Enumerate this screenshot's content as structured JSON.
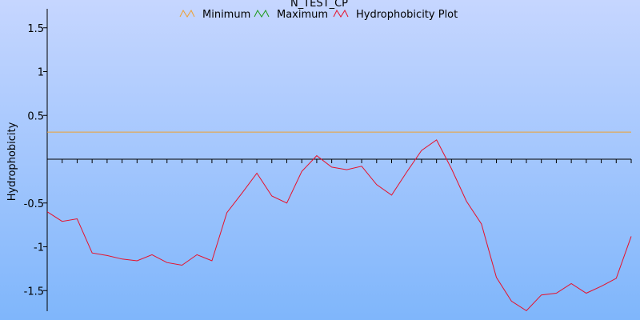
{
  "chart_data": {
    "type": "line",
    "title": "N_TEST_CP",
    "ylabel": "Hydrophobicity",
    "xlabel": "",
    "ylim": [
      -1.73,
      1.72
    ],
    "y_ticks": [
      1.5,
      1,
      0.5,
      -0.5,
      -1,
      -1.5
    ],
    "y_tick_labels": [
      "1.5",
      "1",
      "0.5",
      "-0.5",
      "-1",
      "-1.5"
    ],
    "x_range": [
      0,
      39
    ],
    "x_tick_count": 39,
    "legend_position": "top",
    "grid": false,
    "series": [
      {
        "name": "Minimum",
        "color": "#f0a030",
        "x": [
          0,
          39
        ],
        "values": [
          0.31,
          0.31
        ]
      },
      {
        "name": "Maximum",
        "color": "#1a9a1a",
        "x": [],
        "values": []
      },
      {
        "name": "Hydrophobicity Plot",
        "color": "#e8102a",
        "x": [
          0,
          1,
          2,
          3,
          4,
          5,
          6,
          7,
          8,
          9,
          10,
          11,
          12,
          13,
          14,
          15,
          16,
          17,
          18,
          19,
          20,
          21,
          22,
          23,
          24,
          25,
          26,
          27,
          28,
          29,
          30,
          31,
          32,
          33,
          34,
          35,
          36,
          37,
          38,
          39
        ],
        "values": [
          -0.6,
          -0.71,
          -0.68,
          -1.07,
          -1.1,
          -1.14,
          -1.16,
          -1.09,
          -1.18,
          -1.21,
          -1.09,
          -1.16,
          -0.61,
          -0.39,
          -0.16,
          -0.42,
          -0.5,
          -0.14,
          0.04,
          -0.09,
          -0.12,
          -0.08,
          -0.29,
          -0.41,
          -0.15,
          0.1,
          0.22,
          -0.11,
          -0.48,
          -0.74,
          -1.35,
          -1.62,
          -1.73,
          -1.55,
          -1.53,
          -1.42,
          -1.53,
          -1.45,
          -1.36,
          -0.88
        ]
      }
    ]
  }
}
